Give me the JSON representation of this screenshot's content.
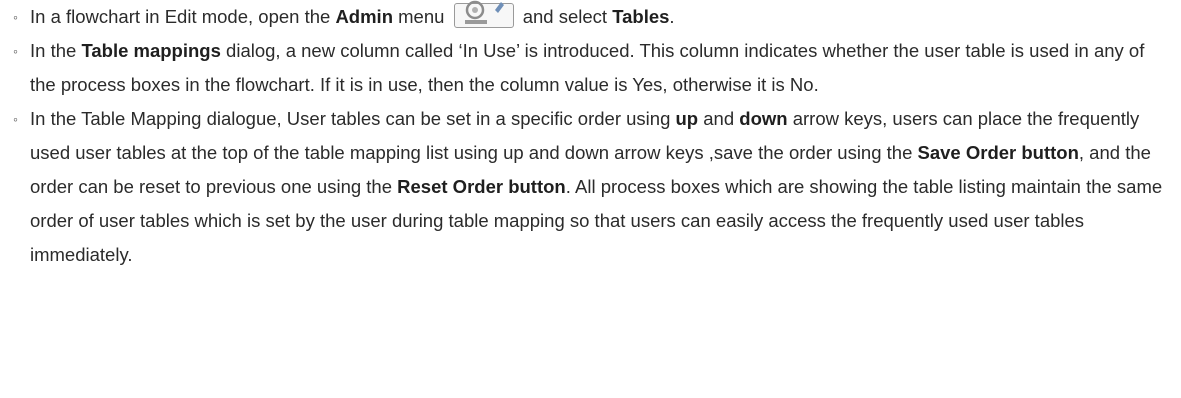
{
  "items": [
    {
      "t1": "In a flowchart in Edit mode, open the ",
      "b1": "Admin",
      "t2": " menu",
      "icon": "admin-menu-icon",
      "t3": " and select ",
      "b2": "Tables",
      "t4": "."
    },
    {
      "t1": "In the ",
      "b1": "Table mappings",
      "t2": " dialog, a new column called ‘In Use’ is introduced. This column indicates whether the user table is used in any of the process boxes in the flowchart. If it is in use, then the column value is Yes, otherwise it is No."
    },
    {
      "t1": "In the Table Mapping dialogue, User tables can be set in a specific order using ",
      "b1": "up",
      "t2": " and ",
      "b2": "down",
      "t3": " arrow keys, users can place the frequently used user tables at the top of the table mapping list using up and down arrow keys ,save the order using the ",
      "b3": "Save Order button",
      "t4": ", and the order can be reset to previous one using the ",
      "b4": "Reset Order button",
      "t5": ". All process boxes which are showing the table listing maintain the same order of user tables which is set by the user during table mapping so that users can easily access the frequently used user tables immediately."
    }
  ]
}
